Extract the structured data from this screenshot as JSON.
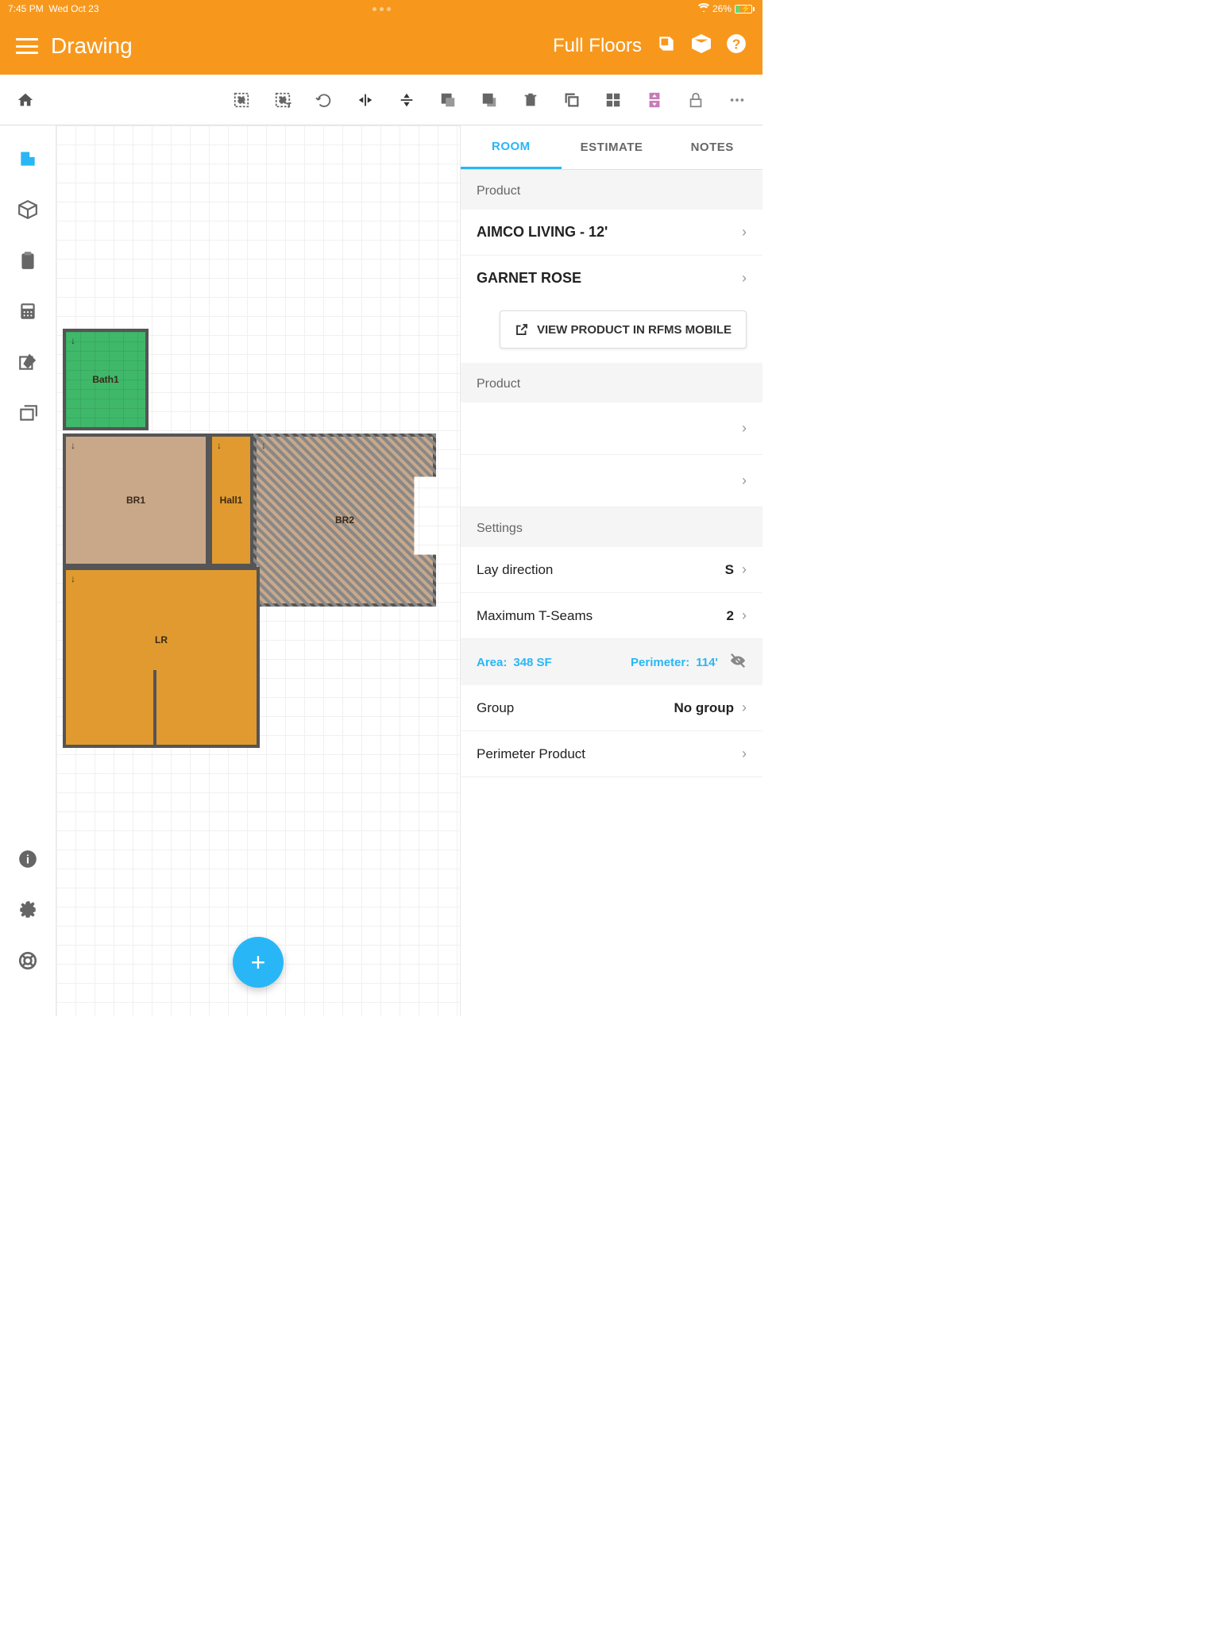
{
  "status": {
    "time": "7:45 PM",
    "date": "Wed Oct 23",
    "battery": "26%"
  },
  "header": {
    "title": "Drawing",
    "fullFloors": "Full Floors"
  },
  "tabs": {
    "room": "ROOM",
    "estimate": "ESTIMATE",
    "notes": "NOTES"
  },
  "sections": {
    "product": "Product",
    "product_line1": "AIMCO LIVING - 12'",
    "product_line2": "GARNET ROSE",
    "view_btn": "VIEW PRODUCT IN RFMS MOBILE",
    "product2": "Product",
    "settings": "Settings",
    "lay_direction_label": "Lay direction",
    "lay_direction_value": "S",
    "tseams_label": "Maximum T-Seams",
    "tseams_value": "2",
    "area_label": "Area:",
    "area_value": "348 SF",
    "perimeter_label": "Perimeter:",
    "perimeter_value": "114'",
    "group_label": "Group",
    "group_value": "No group",
    "perimeter_product": "Perimeter Product"
  },
  "rooms": {
    "bath1": "Bath1",
    "br1": "BR1",
    "hall1": "Hall1",
    "br2": "BR2",
    "lr": "LR"
  }
}
